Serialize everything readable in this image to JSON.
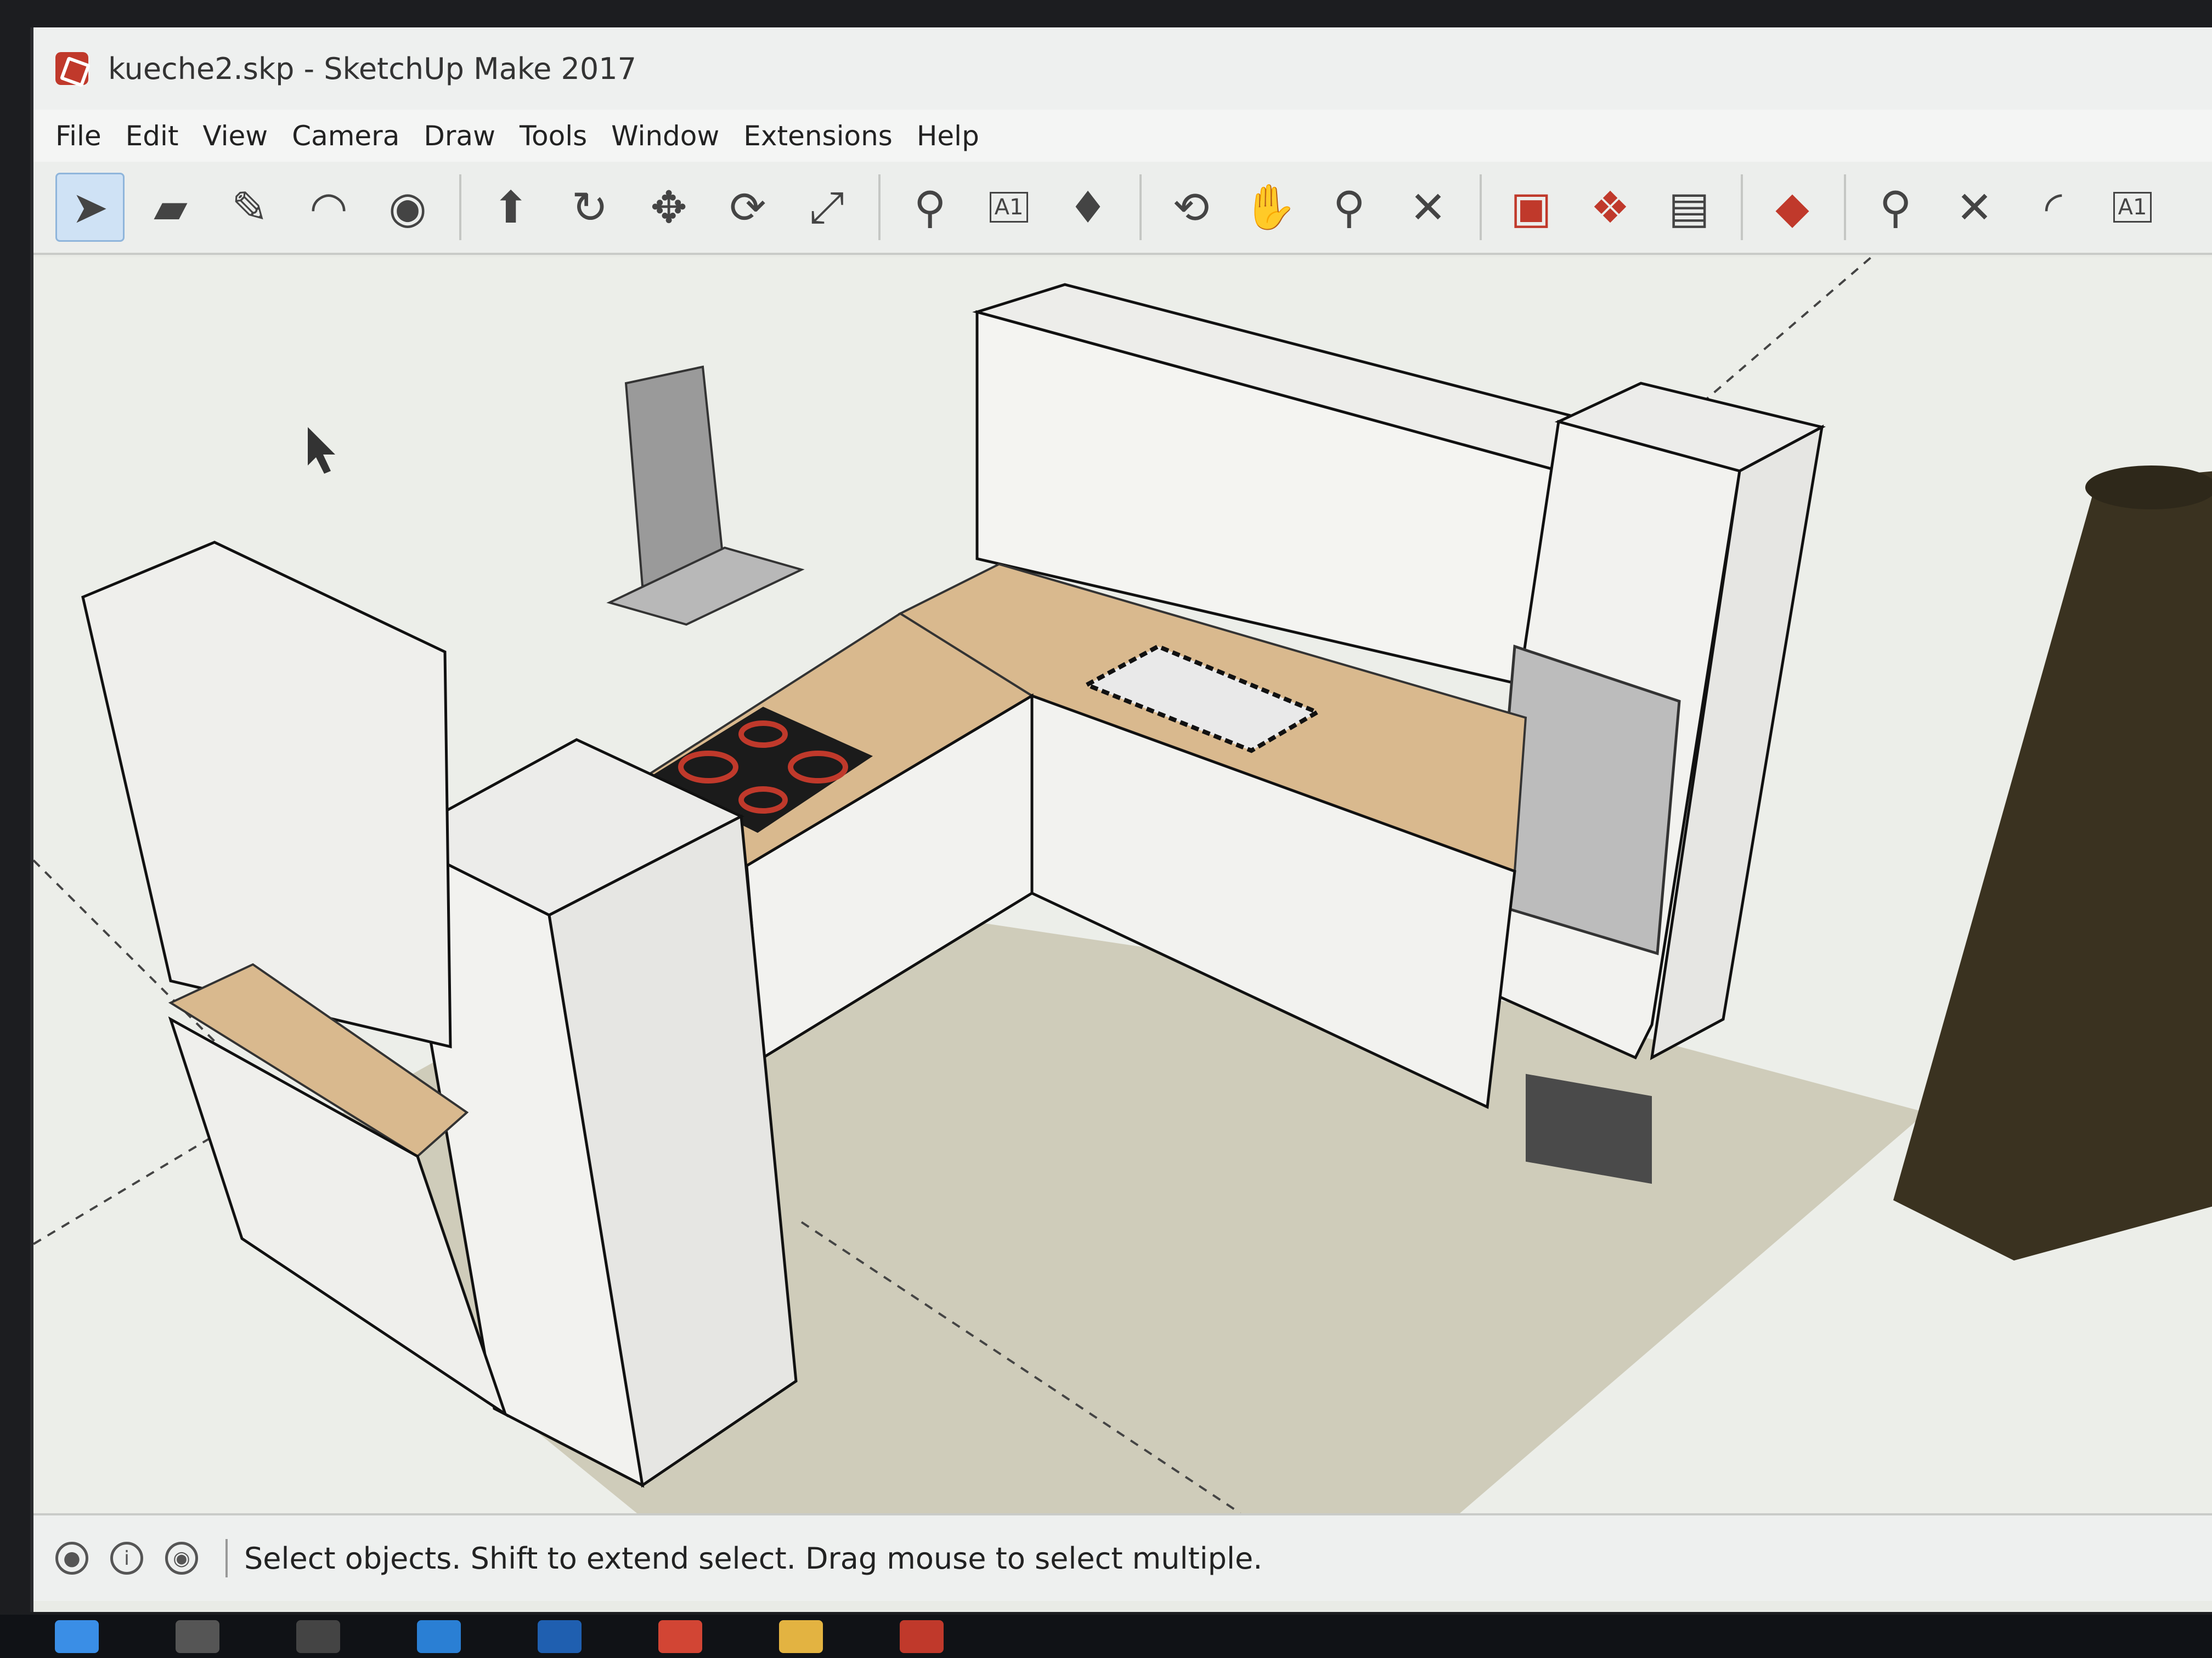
{
  "window": {
    "title": "kueche2.skp - SketchUp Make 2017"
  },
  "menu": [
    "File",
    "Edit",
    "View",
    "Camera",
    "Draw",
    "Tools",
    "Window",
    "Extensions",
    "Help"
  ],
  "toolbar": {
    "tools": [
      {
        "name": "select-tool-icon",
        "glyph": "➤"
      },
      {
        "name": "eraser-tool-icon",
        "glyph": "▰"
      },
      {
        "name": "pencil-tool-icon",
        "glyph": "✎"
      },
      {
        "name": "arc-tool-icon",
        "glyph": "◠"
      },
      {
        "name": "circle-tool-icon",
        "glyph": "◉"
      },
      {
        "name": "push-pull-tool-icon",
        "glyph": "⬆"
      },
      {
        "name": "follow-me-tool-icon",
        "glyph": "↻"
      },
      {
        "name": "move-tool-icon",
        "glyph": "✥"
      },
      {
        "name": "rotate-tool-icon",
        "glyph": "⟳"
      },
      {
        "name": "scale-tool-icon",
        "glyph": "⤢"
      },
      {
        "name": "tape-measure-tool-icon",
        "glyph": "⚲"
      },
      {
        "name": "text-tool-icon",
        "glyph": "A"
      },
      {
        "name": "paint-bucket-tool-icon",
        "glyph": "♦"
      },
      {
        "name": "orbit-tool-icon",
        "glyph": "⟲"
      },
      {
        "name": "pan-tool-icon",
        "glyph": "✋"
      },
      {
        "name": "zoom-tool-icon",
        "glyph": "⚲"
      },
      {
        "name": "zoom-extents-tool-icon",
        "glyph": "✕"
      },
      {
        "name": "warehouse-icon",
        "glyph": "▣"
      },
      {
        "name": "components-icon",
        "glyph": "❖"
      },
      {
        "name": "layout-icon",
        "glyph": "▤"
      },
      {
        "name": "extension-ruby-icon",
        "glyph": "◆"
      },
      {
        "name": "tape-measure-2-icon",
        "glyph": "⚲"
      },
      {
        "name": "dimension-tool-icon",
        "glyph": "✕"
      },
      {
        "name": "protractor-tool-icon",
        "glyph": "◜"
      },
      {
        "name": "text-label-2-icon",
        "glyph": "A"
      }
    ],
    "text_tool_label": "A1"
  },
  "status": {
    "message": "Select objects. Shift to extend select. Drag mouse to select multiple."
  },
  "colors": {
    "wood": "#d9b98e",
    "cabinet": "#f2f2ef",
    "floor": "#cfccba",
    "hob": "#1b1b1b",
    "burner": "#c0392b",
    "log": "#3a3220"
  }
}
